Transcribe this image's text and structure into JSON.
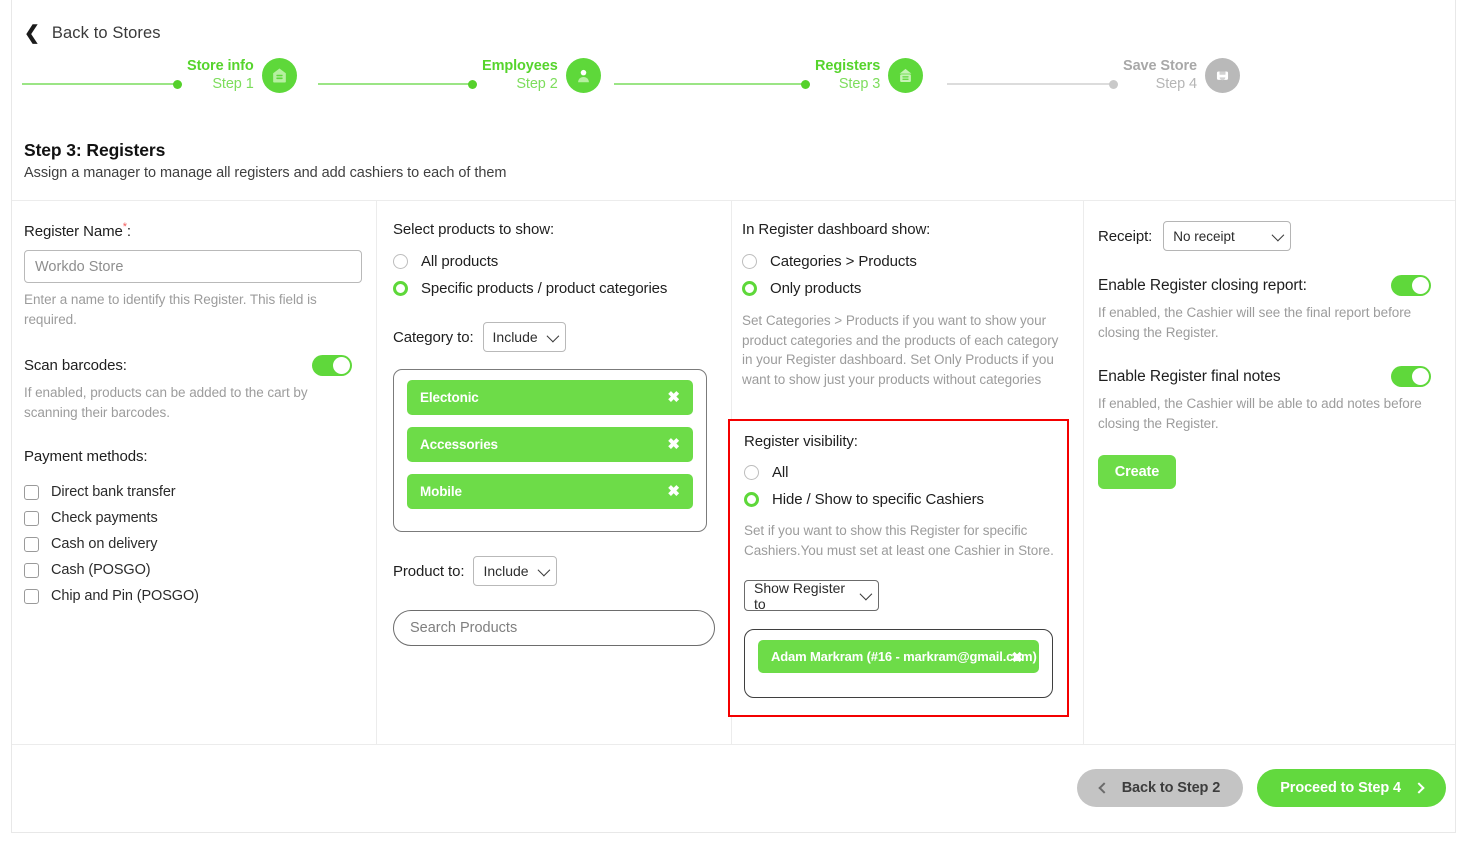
{
  "back_link": {
    "label": "Back to Stores",
    "icon": "chevron-left-icon"
  },
  "stepper": {
    "steps": [
      {
        "name": "Store info",
        "step": "Step 1",
        "icon": "store-icon",
        "state": "done"
      },
      {
        "name": "Employees",
        "step": "Step 2",
        "icon": "user-icon",
        "state": "done"
      },
      {
        "name": "Registers",
        "step": "Step 3",
        "icon": "register-icon",
        "state": "current"
      },
      {
        "name": "Save Store",
        "step": "Step 4",
        "icon": "save-store-icon",
        "state": "pending"
      }
    ],
    "active_color": "#5ed83a",
    "inactive_color": "#b9b9b9"
  },
  "heading": {
    "title": "Step 3: Registers",
    "subtitle": "Assign a manager to manage all registers and add cashiers to each of them"
  },
  "col_register": {
    "name_label": "Register Name",
    "required_mark": "*",
    "colon": ":",
    "name_placeholder": "Workdo Store",
    "name_value": "",
    "name_helper": "Enter a name to identify this Register. This field is required.",
    "scan_label": "Scan barcodes:",
    "scan_toggle": "on",
    "scan_helper": "If enabled, products can be added to the cart by scanning their barcodes.",
    "payment_label": "Payment methods:",
    "payment_methods": [
      {
        "label": "Direct bank transfer",
        "checked": false
      },
      {
        "label": "Check payments",
        "checked": false
      },
      {
        "label": "Cash on delivery",
        "checked": false
      },
      {
        "label": "Cash (POSGO)",
        "checked": false
      },
      {
        "label": "Chip and Pin (POSGO)",
        "checked": false
      }
    ]
  },
  "col_products": {
    "select_label": "Select products to show:",
    "options": [
      {
        "label": "All products",
        "selected": false
      },
      {
        "label": "Specific products / product categories",
        "selected": true
      }
    ],
    "category_to_label": "Category to:",
    "category_to_value": "Include",
    "category_tags": [
      {
        "label": "Electonic"
      },
      {
        "label": "Accessories"
      },
      {
        "label": "Mobile"
      }
    ],
    "product_to_label": "Product to:",
    "product_to_value": "Include",
    "search_placeholder": "Search Products",
    "search_value": "",
    "remove_icon": "close-icon"
  },
  "col_dashboard": {
    "dashboard_label": "In Register dashboard show:",
    "options": [
      {
        "label": "Categories > Products",
        "selected": false
      },
      {
        "label": "Only products",
        "selected": true
      }
    ],
    "helper": "Set Categories > Products if you want to show your product categories and the products of each category in your Register dashboard. Set Only Products if you want to show just your products without categories",
    "visibility_label": "Register visibility:",
    "visibility_options": [
      {
        "label": "All",
        "selected": false
      },
      {
        "label": "Hide / Show to specific Cashiers",
        "selected": true
      }
    ],
    "visibility_helper": "Set if you want to show this Register for specific Cashiers.You must set at least one Cashier in Store.",
    "show_register_to_value": "Show Register to",
    "cashier_tags": [
      {
        "label": "Adam Markram (#16 - markram@gmail.com)"
      }
    ],
    "highlight_color": "#f40000",
    "remove_icon": "close-icon"
  },
  "col_receipt": {
    "receipt_label": "Receipt:",
    "receipt_value": "No receipt",
    "closing_report_label": "Enable Register closing report:",
    "closing_report_toggle": "on",
    "closing_report_helper": "If enabled, the Cashier will see the final report before closing the Register.",
    "final_notes_label": "Enable Register final notes",
    "final_notes_toggle": "on",
    "final_notes_helper": "If enabled, the Cashier will be able to add notes before closing the Register.",
    "create_label": "Create"
  },
  "footer": {
    "back_label": "Back to Step 2",
    "next_label": "Proceed to Step 4",
    "back_icon": "chevron-left-icon",
    "next_icon": "chevron-right-icon"
  }
}
